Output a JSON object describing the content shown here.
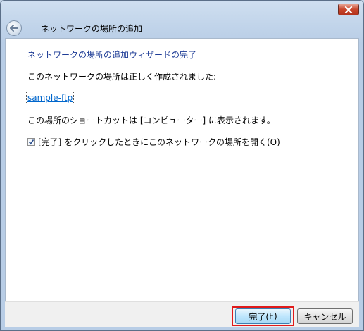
{
  "window": {
    "title": "ネットワークの場所の追加",
    "close_icon": "close-icon",
    "back_icon": "back-arrow-icon"
  },
  "content": {
    "heading": "ネットワークの場所の追加ウィザードの完了",
    "success_message": "このネットワークの場所は正しく作成されました:",
    "location_link": "sample-ftp",
    "shortcut_message": "この場所のショートカットは [コンピューター] に表示されます。",
    "open_checkbox": {
      "label_prefix": "[完了] をクリックしたときにこのネットワークの場所を開く(",
      "accelerator": "O",
      "label_suffix": ")",
      "checked": true
    }
  },
  "footer": {
    "finish": {
      "prefix": "完了(",
      "accelerator": "F",
      "suffix": ")"
    },
    "cancel_label": "キャンセル"
  },
  "colors": {
    "heading": "#1e3c96",
    "link": "#0066cc",
    "highlight": "#e01a1a",
    "close_button": "#c8452a"
  }
}
